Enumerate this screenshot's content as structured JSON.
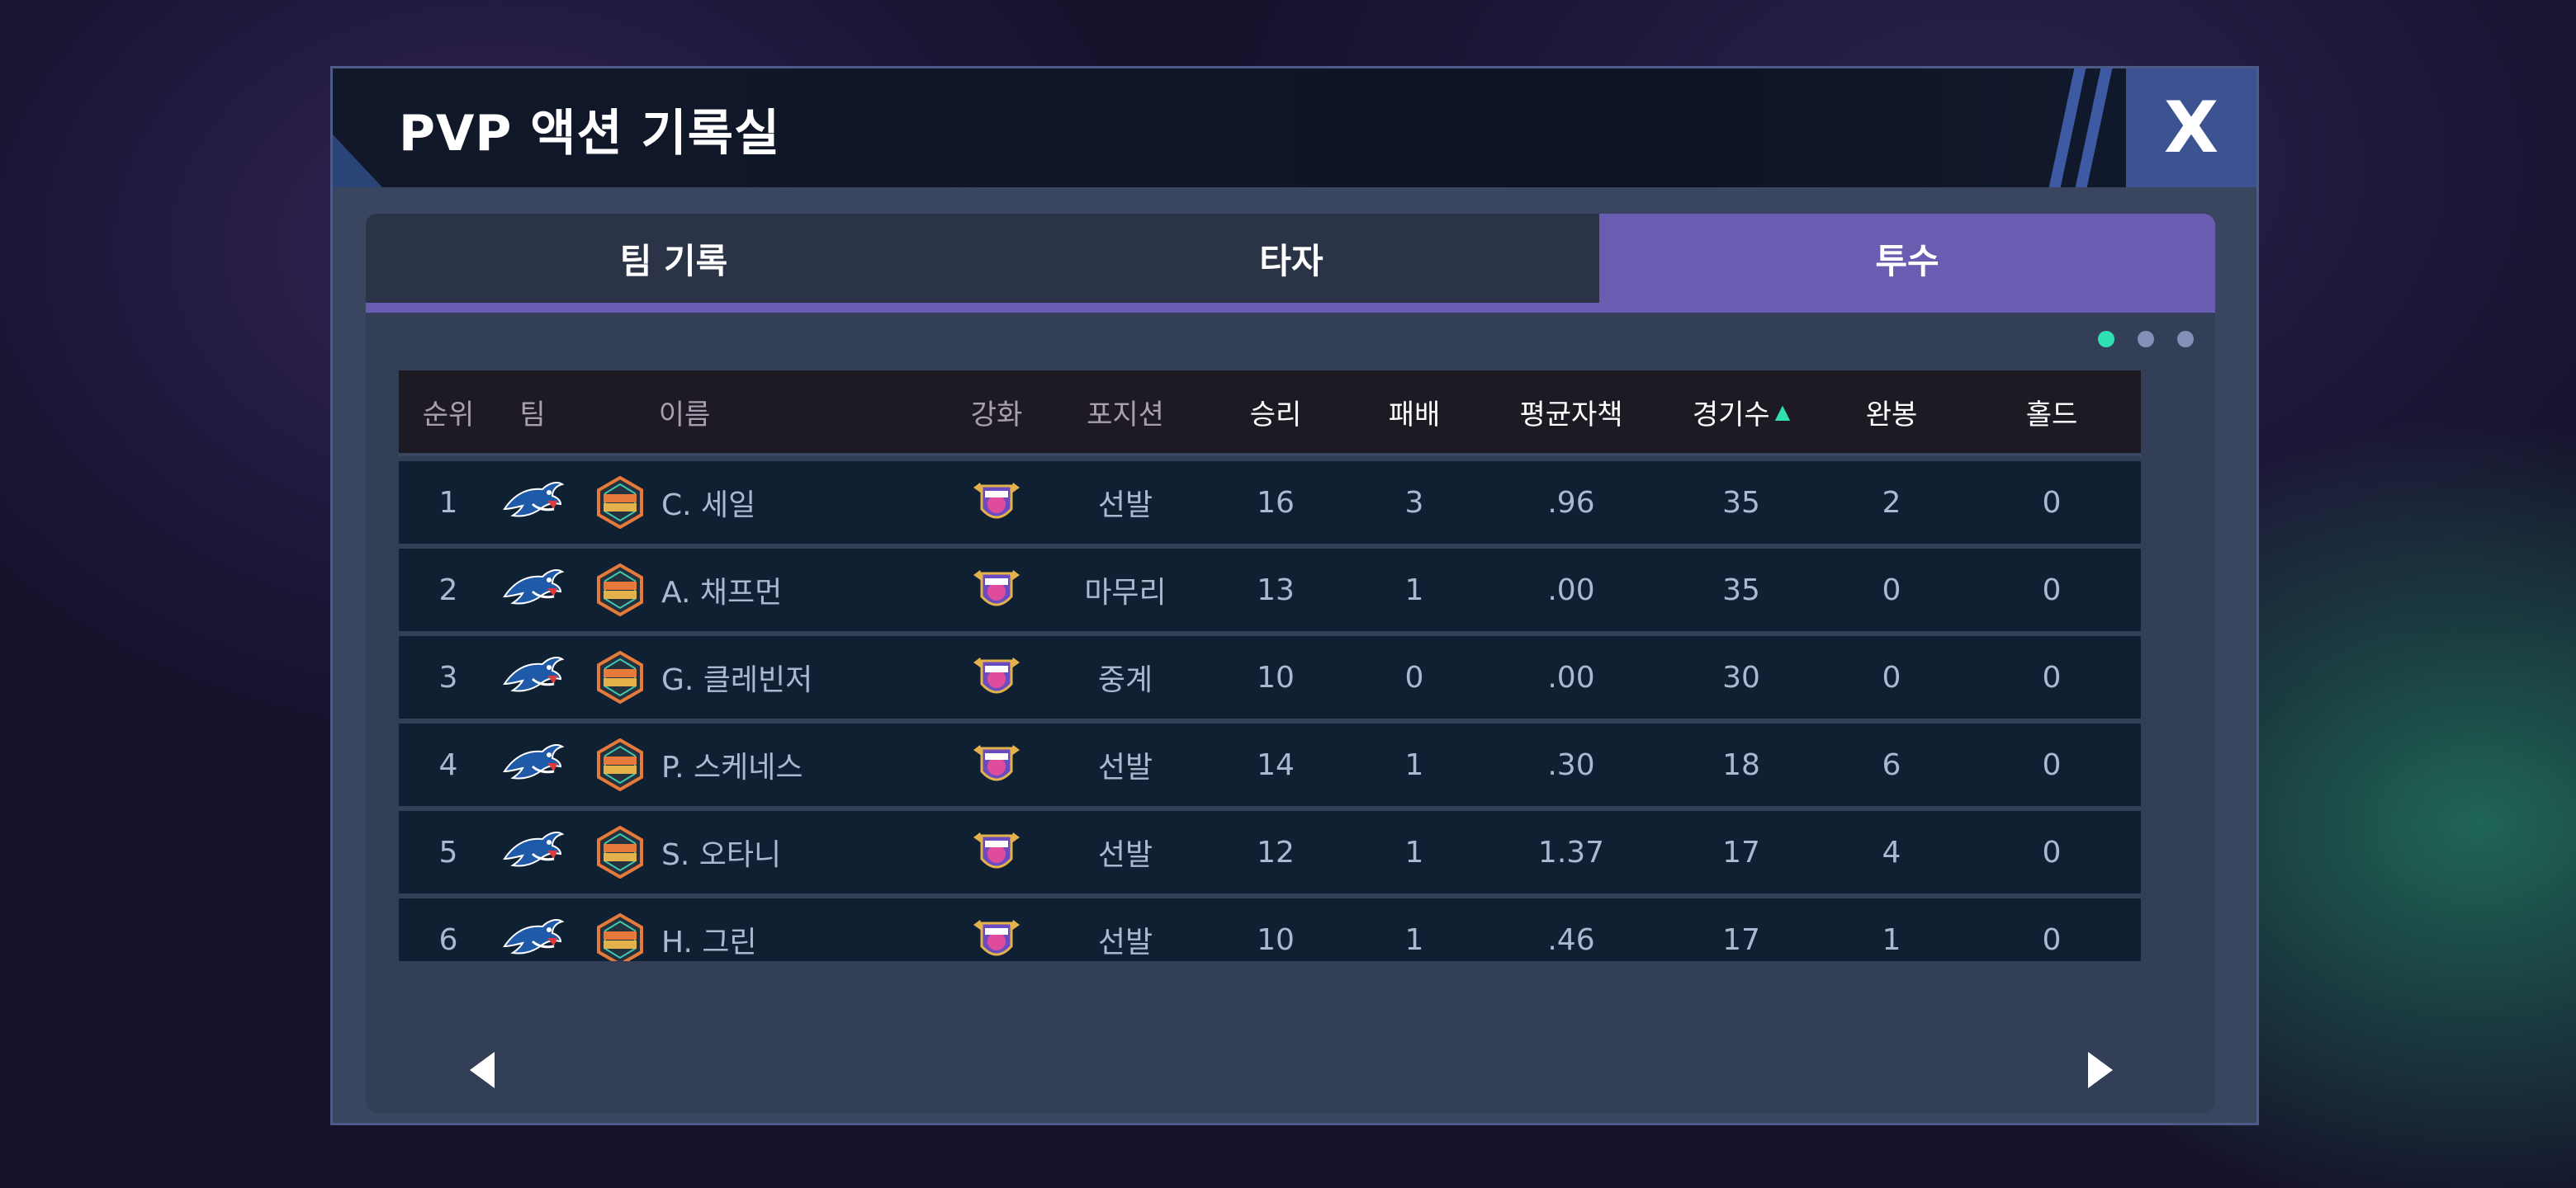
{
  "dialog": {
    "title": "PVP 액션 기록실",
    "close_label": "X"
  },
  "tabs": [
    {
      "label": "팀 기록",
      "active": false
    },
    {
      "label": "타자",
      "active": false
    },
    {
      "label": "투수",
      "active": true
    }
  ],
  "page_indicator": {
    "total": 3,
    "current": 1
  },
  "table": {
    "headers": {
      "rank": "순위",
      "team": "팀",
      "name": "이름",
      "upgrade": "강화",
      "position": "포지션",
      "wins": "승리",
      "losses": "패배",
      "era": "평균자책",
      "games": "경기수",
      "complete_shutouts": "완봉",
      "holds": "홀드"
    },
    "sort": {
      "column": "games",
      "direction": "ascending-arrow"
    },
    "rows": [
      {
        "rank": "1",
        "name": "C. 세일",
        "position": "선발",
        "wins": "16",
        "losses": "3",
        "era": ".96",
        "games": "35",
        "complete_shutouts": "2",
        "holds": "0"
      },
      {
        "rank": "2",
        "name": "A. 채프먼",
        "position": "마무리",
        "wins": "13",
        "losses": "1",
        "era": ".00",
        "games": "35",
        "complete_shutouts": "0",
        "holds": "0"
      },
      {
        "rank": "3",
        "name": "G. 클레빈저",
        "position": "중계",
        "wins": "10",
        "losses": "0",
        "era": ".00",
        "games": "30",
        "complete_shutouts": "0",
        "holds": "0"
      },
      {
        "rank": "4",
        "name": "P. 스케네스",
        "position": "선발",
        "wins": "14",
        "losses": "1",
        "era": ".30",
        "games": "18",
        "complete_shutouts": "6",
        "holds": "0"
      },
      {
        "rank": "5",
        "name": "S. 오타니",
        "position": "선발",
        "wins": "12",
        "losses": "1",
        "era": "1.37",
        "games": "17",
        "complete_shutouts": "4",
        "holds": "0"
      },
      {
        "rank": "6",
        "name": "H. 그린",
        "position": "선발",
        "wins": "10",
        "losses": "1",
        "era": ".46",
        "games": "17",
        "complete_shutouts": "1",
        "holds": "0"
      }
    ]
  },
  "icons": {
    "team_logo": "blue-jay-logo-icon",
    "grade_badge": "superstar-badge-icon",
    "upgrade_badge": "upgrade-level-badge-icon",
    "prev": "arrow-left-icon",
    "next": "arrow-right-icon"
  },
  "colors": {
    "accent": "#6a5cb0",
    "active_dot": "#2fe0b0",
    "row_bg": "#0f2033"
  }
}
